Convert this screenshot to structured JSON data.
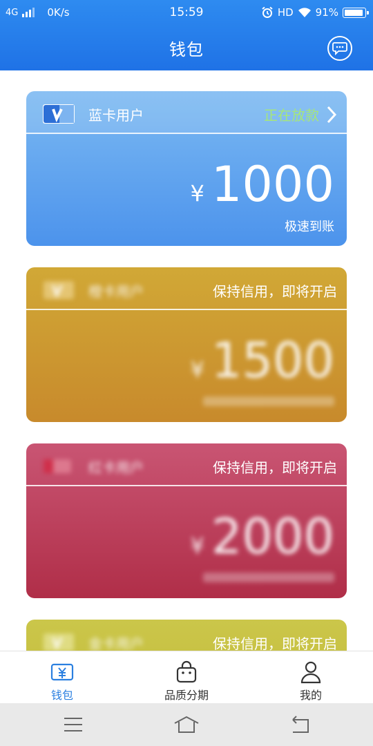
{
  "status_bar": {
    "network": "4G",
    "speed": "0K/s",
    "time": "15:59",
    "hd": "HD",
    "battery": "91%"
  },
  "header": {
    "title": "钱包",
    "message_icon": "chat-bubble-icon"
  },
  "cards": [
    {
      "name": "蓝卡用户",
      "status": "正在放款",
      "currency": "¥",
      "amount": "1000",
      "subtitle": "极速到账",
      "color": "#5aa2ee",
      "status_color": "#a6e67a"
    },
    {
      "name": "橙卡用户",
      "status": "保持信用，即将开启",
      "currency": "¥",
      "amount": "1500",
      "subtitle": "",
      "color": "#cc9a31"
    },
    {
      "name": "红卡用户",
      "status": "保持信用，即将开启",
      "currency": "¥",
      "amount": "2000",
      "subtitle": "",
      "color": "#bd4058"
    },
    {
      "name": "金卡用户",
      "status": "保持信用，即将开启",
      "color": "#c9c244"
    }
  ],
  "tabbar": {
    "items": [
      {
        "label": "钱包",
        "icon": "wallet-icon",
        "active": true
      },
      {
        "label": "品质分期",
        "icon": "shopping-bag-icon",
        "active": false
      },
      {
        "label": "我的",
        "icon": "user-icon",
        "active": false
      }
    ],
    "active_color": "#2a7fe0"
  },
  "system_nav": {
    "icons": [
      "menu-icon",
      "home-icon",
      "back-icon"
    ]
  }
}
